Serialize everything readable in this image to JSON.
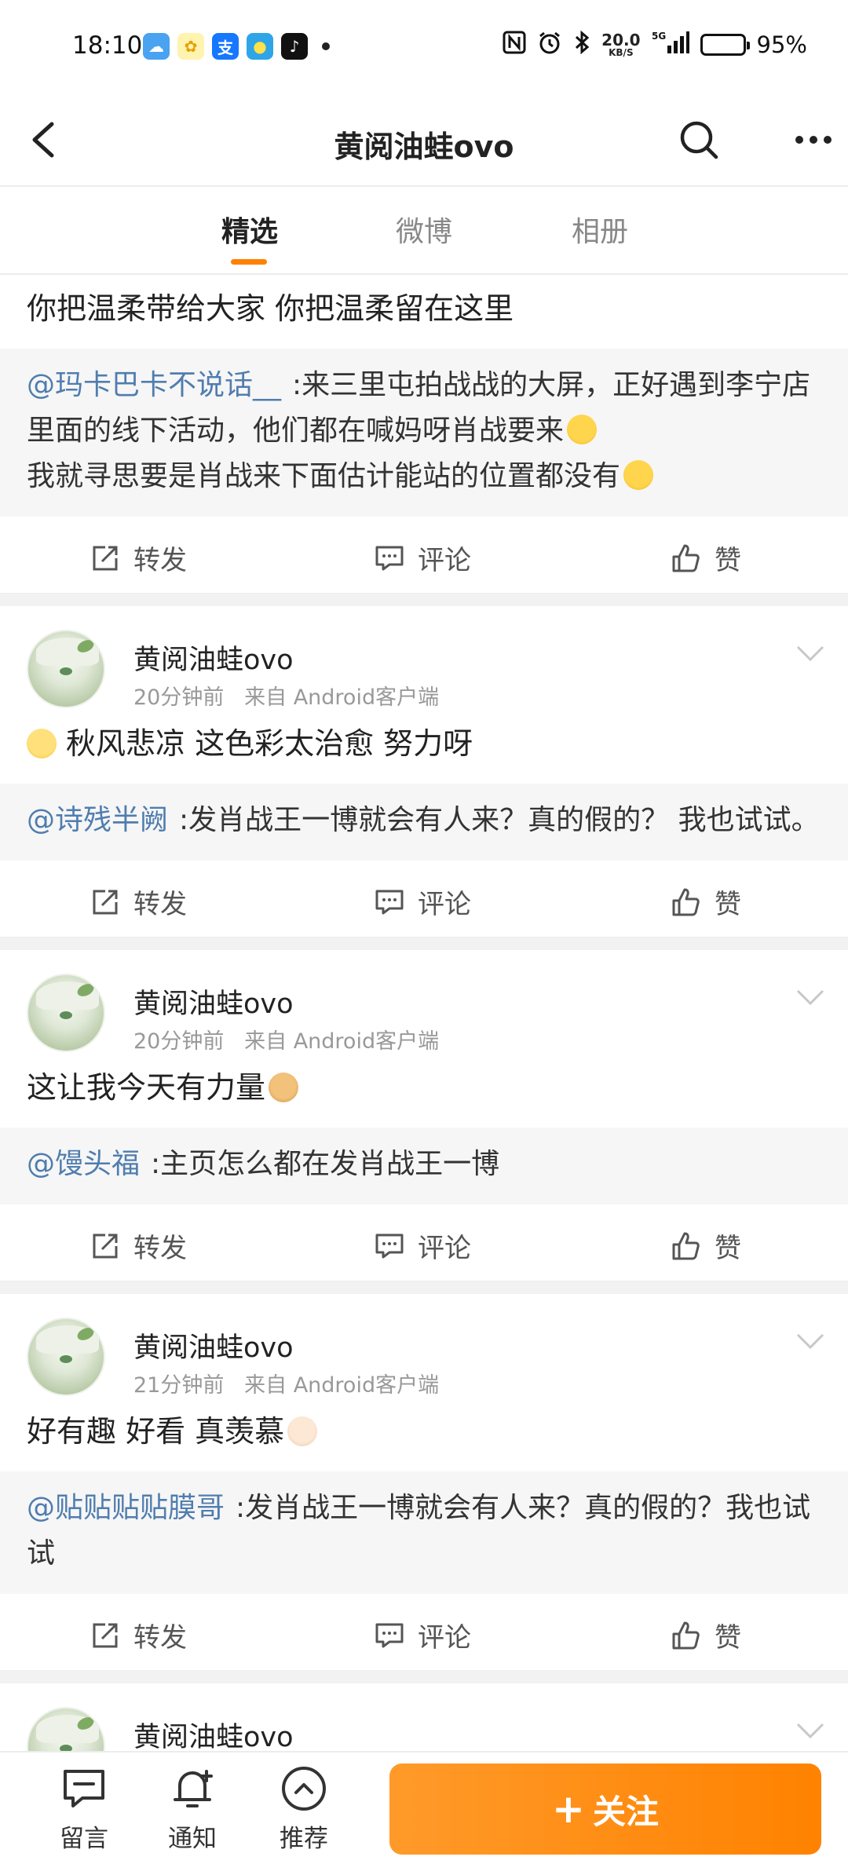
{
  "status_bar": {
    "time": "18:10",
    "net_speed_value": "20.0",
    "net_speed_unit": "KB/S",
    "signal_label": "5G",
    "battery_percent": "95%",
    "battery_level": 0.95,
    "app_icons": [
      "weather-icon",
      "bunny-app-icon",
      "alipay-icon",
      "chat-app-icon",
      "douyin-icon"
    ]
  },
  "header": {
    "title": "黄阅油蛙ovo"
  },
  "tabs": [
    {
      "label": "精选",
      "active": true
    },
    {
      "label": "微博",
      "active": false
    },
    {
      "label": "相册",
      "active": false
    }
  ],
  "posts": [
    {
      "text": "你把温柔带给大家  你把温柔留在这里",
      "quote_user": "@玛卡巴卡不说话__",
      "quote_text": ":来三里屯拍战战的大屏，正好遇到李宁店里面的线下活动，他们都在喊妈呀肖战要来",
      "quote_text2": "我就寻思要是肖战来下面估计能站的位置都没有"
    },
    {
      "username": "黄阅油蛙ovo",
      "time": "20分钟前",
      "source": "来自  Android客户端",
      "text": "秋风悲凉  这色彩太治愈  努力呀",
      "quote_user": "@诗残半阙",
      "quote_text": ":发肖战王一博就会有人来？真的假的？  我也试试。"
    },
    {
      "username": "黄阅油蛙ovo",
      "time": "20分钟前",
      "source": "来自  Android客户端",
      "text": "这让我今天有力量",
      "quote_user": "@馒头福",
      "quote_text": ":主页怎么都在发肖战王一博"
    },
    {
      "username": "黄阅油蛙ovo",
      "time": "21分钟前",
      "source": "来自  Android客户端",
      "text": "好有趣  好看  真羡慕",
      "quote_user": "@贴贴贴贴膜哥",
      "quote_text": ":发肖战王一博就会有人来？真的假的？我也试试"
    },
    {
      "username": "黄阅油蛙ovo"
    }
  ],
  "actions": {
    "repost": "转发",
    "comment": "评论",
    "like": "赞"
  },
  "bottom_bar": {
    "message": "留言",
    "notify": "通知",
    "recommend": "推荐",
    "follow": "关注",
    "follow_plus": "+"
  },
  "colors": {
    "accent": "#ff8200",
    "link": "#507daf"
  }
}
